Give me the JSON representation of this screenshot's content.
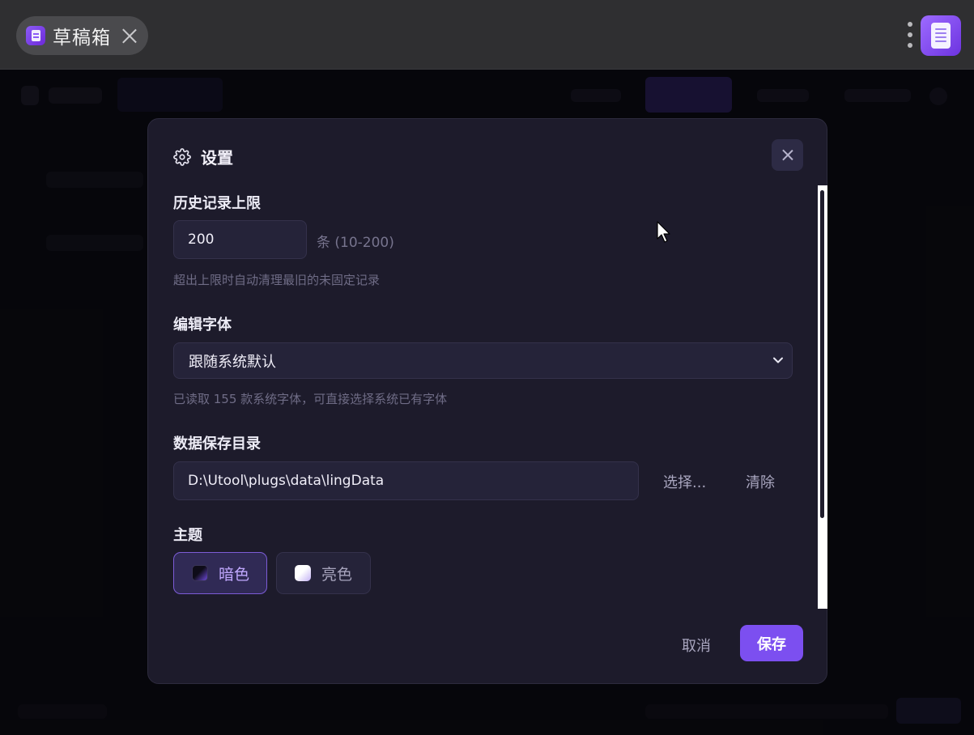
{
  "window": {
    "tab_title": "草稿箱",
    "tab_close_icon": "close-icon",
    "menu_icon": "more-vertical-icon",
    "app_icon": "notepad-icon"
  },
  "colors": {
    "accent": "#7c4ff0",
    "modal_bg": "#1d1b2b",
    "input_bg": "#252339"
  },
  "settings": {
    "title": "设置",
    "title_icon": "gear-icon",
    "close_icon": "close-icon",
    "history": {
      "label": "历史记录上限",
      "value": "200",
      "unit": "条 (10-200)",
      "hint": "超出上限时自动清理最旧的未固定记录"
    },
    "font": {
      "label": "编辑字体",
      "selected": "跟随系统默认",
      "hint": "已读取 155 款系统字体，可直接选择系统已有字体"
    },
    "data_dir": {
      "label": "数据保存目录",
      "path": "D:\\Utool\\plugs\\data\\lingData",
      "choose_label": "选择...",
      "clear_label": "清除"
    },
    "theme": {
      "label": "主题",
      "options": [
        {
          "label": "暗色",
          "selected": true
        },
        {
          "label": "亮色",
          "selected": false
        }
      ]
    },
    "footer": {
      "cancel_label": "取消",
      "save_label": "保存"
    }
  }
}
